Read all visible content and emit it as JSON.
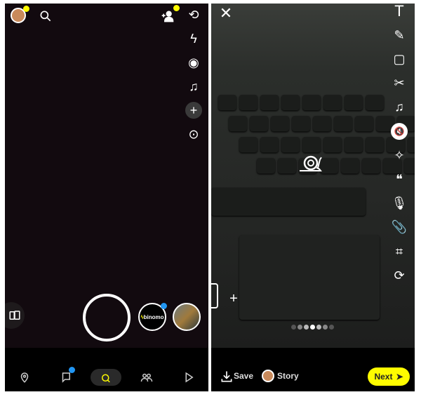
{
  "camera": {
    "story_label": "binomo",
    "nav": [
      {
        "icon": "map-pin-icon"
      },
      {
        "icon": "chat-icon",
        "badge": true
      },
      {
        "icon": "camera-lens-icon",
        "active": true
      },
      {
        "icon": "friends-icon"
      },
      {
        "icon": "play-icon"
      }
    ],
    "right_tools": [
      "flip-camera-icon",
      "flash-off-icon",
      "video-chat-icon",
      "music-icon",
      "plus-icon",
      "scan-icon"
    ]
  },
  "editor": {
    "tools": [
      "text-icon",
      "pencil-icon",
      "sticker-icon",
      "scissors-icon",
      "music-icon",
      "mute-icon",
      "lens-icon",
      "quote-icon",
      "microphone-icon",
      "paperclip-icon",
      "crop-icon",
      "loop-icon"
    ],
    "save_label": "Save",
    "story_label": "Story",
    "next_label": "Next",
    "page_dots": 7,
    "active_dot": 3,
    "speed_icon": "snail-icon"
  },
  "colors": {
    "accent": "#fffc00",
    "badge": "#2196f3"
  }
}
